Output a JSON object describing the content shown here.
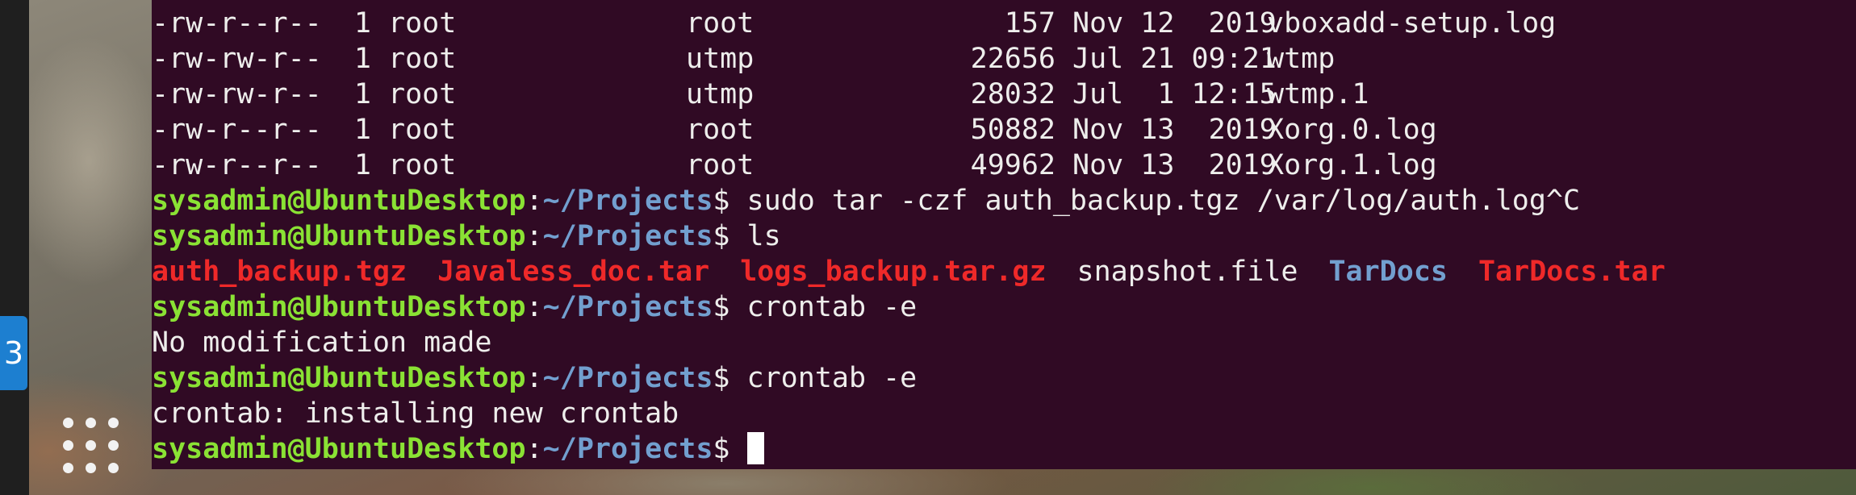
{
  "dock": {
    "workspace_badge": "3"
  },
  "terminal": {
    "ls_rows": [
      {
        "perms": "-rw-r--r--",
        "links": "1",
        "owner": "root",
        "group": "root",
        "size": "157",
        "date": "Nov 12  2019",
        "name": "vboxadd-setup.log"
      },
      {
        "perms": "-rw-rw-r--",
        "links": "1",
        "owner": "root",
        "group": "utmp",
        "size": "22656",
        "date": "Jul 21 09:21",
        "name": "wtmp"
      },
      {
        "perms": "-rw-rw-r--",
        "links": "1",
        "owner": "root",
        "group": "utmp",
        "size": "28032",
        "date": "Jul  1 12:15",
        "name": "wtmp.1"
      },
      {
        "perms": "-rw-r--r--",
        "links": "1",
        "owner": "root",
        "group": "root",
        "size": "50882",
        "date": "Nov 13  2019",
        "name": "Xorg.0.log"
      },
      {
        "perms": "-rw-r--r--",
        "links": "1",
        "owner": "root",
        "group": "root",
        "size": "49962",
        "date": "Nov 13  2019",
        "name": "Xorg.1.log"
      }
    ],
    "prompt": {
      "user_host": "sysadmin@UbuntuDesktop",
      "colon": ":",
      "path": "~/Projects",
      "symbol": "$"
    },
    "commands": [
      " sudo tar -czf auth_backup.tgz /var/log/auth.log^C",
      " ls",
      " crontab -e",
      " crontab -e",
      " "
    ],
    "ls_output": [
      {
        "name": "auth_backup.tgz",
        "kind": "archive"
      },
      {
        "name": "Javaless_doc.tar",
        "kind": "archive"
      },
      {
        "name": "logs_backup.tar.gz",
        "kind": "archive"
      },
      {
        "name": "snapshot.file",
        "kind": "file"
      },
      {
        "name": "TarDocs",
        "kind": "dir"
      },
      {
        "name": "TarDocs.tar",
        "kind": "archive"
      }
    ],
    "outputs": [
      "No modification made",
      "crontab: installing new crontab"
    ],
    "colors": {
      "background": "#300a24",
      "prompt_user": "#8ae234",
      "prompt_path": "#729fcf",
      "archive": "#ef2929",
      "directory": "#729fcf",
      "text": "#eeeeec"
    }
  }
}
